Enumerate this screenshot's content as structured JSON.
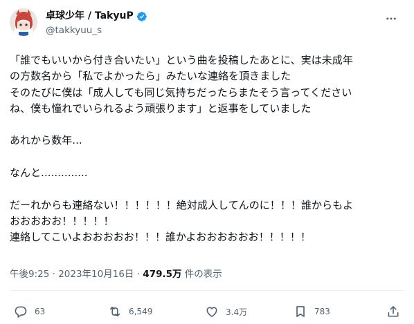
{
  "author": {
    "display_name": "卓球少年 / TakyuP",
    "handle": "@takkyuu_s",
    "verified": true
  },
  "tweet": {
    "text": "「誰でもいいから付き合いたい」という曲を投稿したあとに、実は未成年\nの方数名から「私でよかったら」みたいな連絡を頂きました\nそのたびに僕は「成人しても同じ気持ちだったらまたそう言ってください\nね、僕も憧れでいられるよう頑張ります」と返事をしていました\n\nあれから数年...\n\nなんと..............\n\nだーれからも連絡ない！！！！！！絶対成人してんのに！！！誰からもよ\nおおおおお！！！！！\n連絡してこいよおおおおお！！！誰かよおおおおおお！！！！！"
  },
  "meta": {
    "time": "午後9:25",
    "separator": " · ",
    "date": "2023年10月16日",
    "separator2": " · ",
    "views_count": "479.5万",
    "views_label": " 件の表示"
  },
  "actions": {
    "reply_count": "63",
    "retweet_count": "6,549",
    "like_count": "3.4万",
    "bookmark_count": "783"
  },
  "icons": {
    "more": "more-horizontal-icon",
    "verified": "verified-badge-icon",
    "reply": "reply-icon",
    "retweet": "retweet-icon",
    "like": "heart-icon",
    "bookmark": "bookmark-icon",
    "share": "share-icon"
  },
  "colors": {
    "text": "#0f1419",
    "secondary": "#536471",
    "verified": "#1d9bf0",
    "avatar_hair": "#c8463a"
  }
}
